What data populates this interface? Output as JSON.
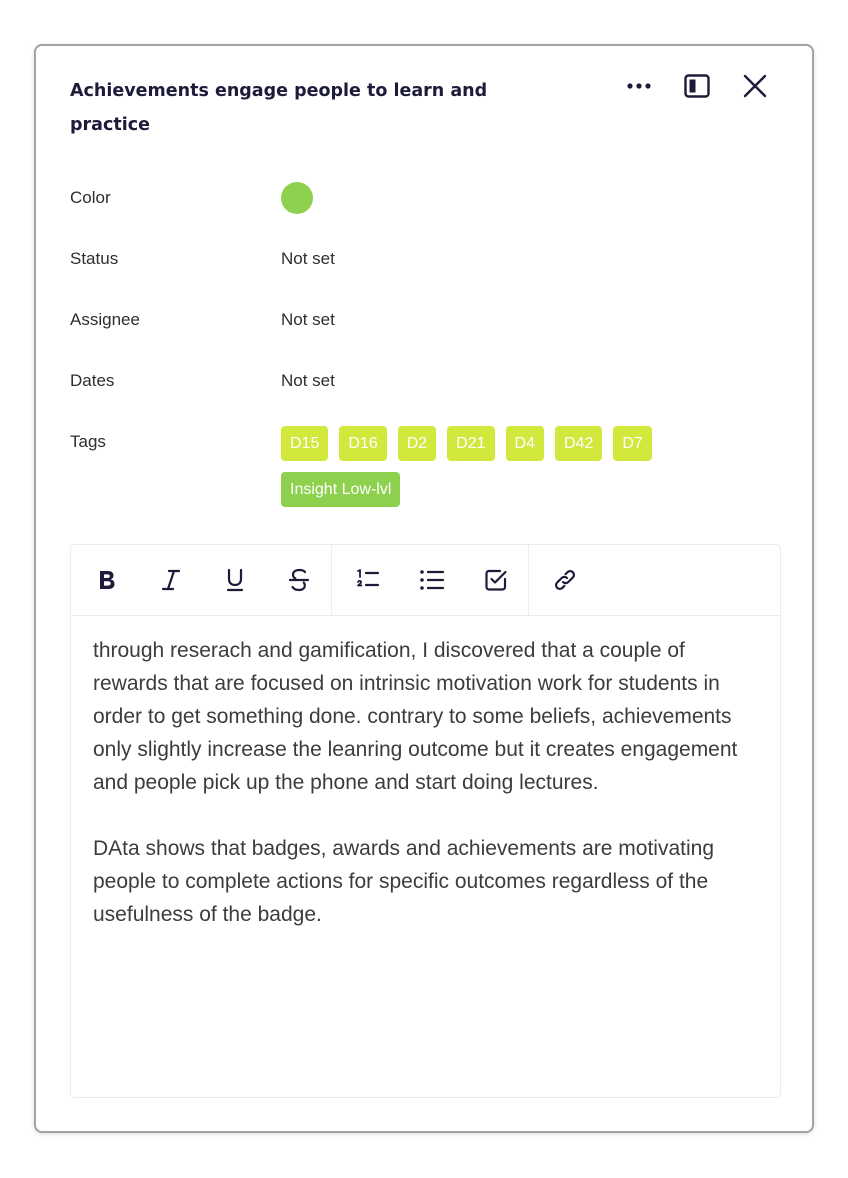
{
  "card": {
    "title": "Achievements engage people to learn and practice",
    "actions": {
      "more_icon": "more-horizontal-icon",
      "expand_icon": "side-panel-icon",
      "close_icon": "close-icon"
    }
  },
  "properties": {
    "color": {
      "label": "Color",
      "value_color": "#8ed14f"
    },
    "status": {
      "label": "Status",
      "value": "Not set"
    },
    "assignee": {
      "label": "Assignee",
      "value": "Not set"
    },
    "dates": {
      "label": "Dates",
      "value": "Not set"
    },
    "tags": {
      "label": "Tags",
      "items": [
        {
          "label": "D15",
          "color": "#d3e83c"
        },
        {
          "label": "D16",
          "color": "#d3e83c"
        },
        {
          "label": "D2",
          "color": "#d3e83c"
        },
        {
          "label": "D21",
          "color": "#d3e83c"
        },
        {
          "label": "D4",
          "color": "#d3e83c"
        },
        {
          "label": "D42",
          "color": "#d3e83c"
        },
        {
          "label": "D7",
          "color": "#d3e83c"
        },
        {
          "label": "Insight Low-lvl",
          "color": "#8ed14f"
        }
      ]
    }
  },
  "editor": {
    "toolbar": {
      "bold": "bold-icon",
      "italic": "italic-icon",
      "underline": "underline-icon",
      "strikethrough": "strikethrough-icon",
      "numbered_list": "numbered-list-icon",
      "bullet_list": "bullet-list-icon",
      "checklist": "checklist-icon",
      "link": "link-icon"
    },
    "paragraphs": [
      "through reserach and gamification, I discovered that a couple of rewards that are focused on intrinsic motivation work for students in order to get something  done. contrary to some beliefs, achievements only slightly increase the leanring outcome but it creates engagement and people pick up the phone and start doing lectures.",
      "DAta shows that badges, awards and achievements are motivating people to complete actions for specific outcomes regardless of the usefulness of the badge."
    ]
  }
}
